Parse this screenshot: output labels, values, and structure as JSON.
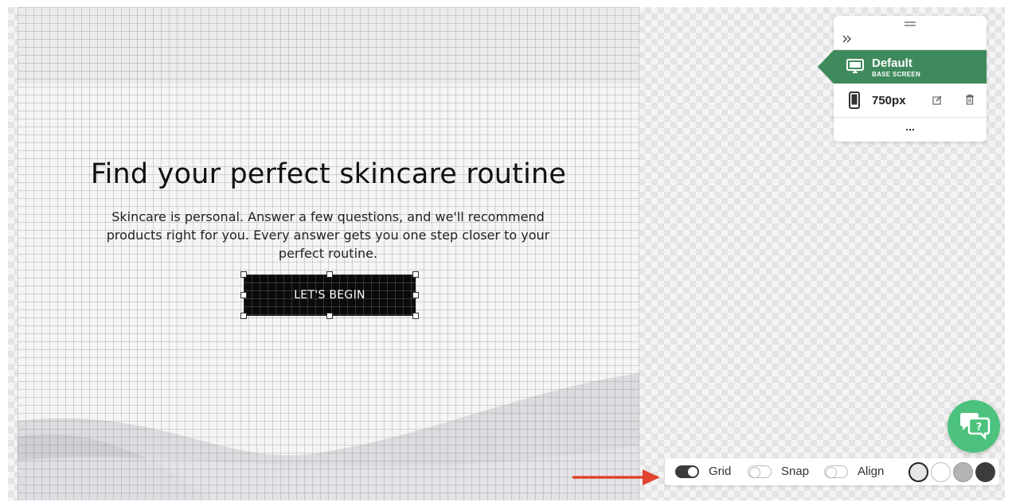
{
  "canvas": {
    "title": "Find your perfect skincare routine",
    "subtitle": "Skincare is personal. Answer a few questions, and we'll recommend products right for you. Every answer gets you one step closer to your perfect routine.",
    "cta_label": "LET'S BEGIN"
  },
  "breakpoints_panel": {
    "collapse_icon": "double-chevron-right-icon",
    "items": [
      {
        "label": "Default",
        "sublabel": "BASE SCREEN",
        "icon": "desktop-icon",
        "active": true
      },
      {
        "label": "750px",
        "icon": "mobile-icon",
        "active": false
      }
    ],
    "more_label": "..."
  },
  "toolbar": {
    "grid_label": "Grid",
    "grid_on": true,
    "snap_label": "Snap",
    "snap_on": false,
    "align_label": "Align",
    "align_on": false,
    "backgrounds": [
      {
        "name": "transparent",
        "color": "#e6e6e6",
        "selected": true
      },
      {
        "name": "white",
        "color": "#ffffff",
        "selected": false
      },
      {
        "name": "gray",
        "color": "#b3b3b3",
        "selected": false
      },
      {
        "name": "dark",
        "color": "#3c3c3c",
        "selected": false
      }
    ]
  },
  "colors": {
    "accent_green": "#3f8a5c",
    "chat_green": "#4cc27e",
    "annotation_arrow": "#e0442e"
  }
}
